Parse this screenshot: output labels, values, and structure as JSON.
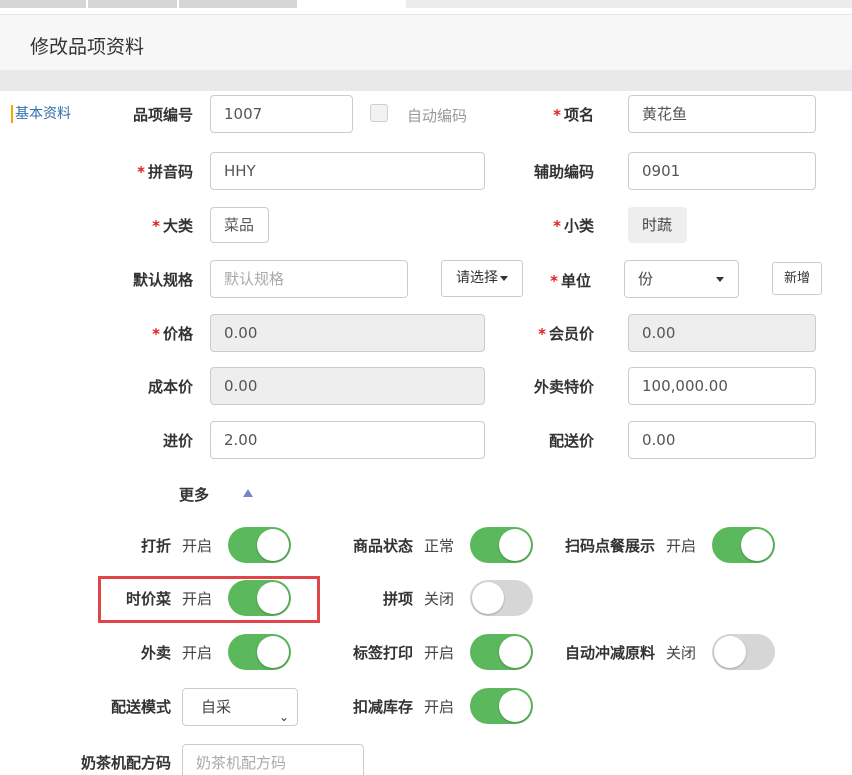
{
  "page": {
    "title": "修改品项资料",
    "side_tab": "基本资料"
  },
  "fields": {
    "code": {
      "label": "品项编号",
      "value": "1007"
    },
    "auto_code": {
      "label": "自动编码",
      "checked": false
    },
    "name": {
      "label": "项名",
      "required": true,
      "value": "黄花鱼"
    },
    "pinyin": {
      "label": "拼音码",
      "required": true,
      "value": "HHY"
    },
    "aux_code": {
      "label": "辅助编码",
      "value": "0901"
    },
    "category": {
      "label": "大类",
      "required": true,
      "value": "菜品"
    },
    "subcategory": {
      "label": "小类",
      "required": true,
      "value": "时蔬"
    },
    "default_spec": {
      "label": "默认规格",
      "placeholder": "默认规格",
      "select_button": "请选择"
    },
    "unit": {
      "label": "单位",
      "required": true,
      "value": "份",
      "add_button": "新增"
    },
    "price": {
      "label": "价格",
      "required": true,
      "value": "0.00"
    },
    "member_price": {
      "label": "会员价",
      "required": true,
      "value": "0.00"
    },
    "cost_price": {
      "label": "成本价",
      "value": "0.00"
    },
    "takeout_special": {
      "label": "外卖特价",
      "value": "100,000.00"
    },
    "purchase_price": {
      "label": "进价",
      "value": "2.00"
    },
    "delivery_price": {
      "label": "配送价",
      "value": "0.00"
    }
  },
  "more": {
    "label": "更多"
  },
  "toggles": {
    "discount": {
      "label": "打折",
      "state_text": "开启",
      "on": true
    },
    "product_status": {
      "label": "商品状态",
      "state_text": "正常",
      "on": true
    },
    "scan_order_display": {
      "label": "扫码点餐展示",
      "state_text": "开启",
      "on": true
    },
    "seasonal_dish": {
      "label": "时价菜",
      "state_text": "开启",
      "on": true
    },
    "combo_item": {
      "label": "拼项",
      "state_text": "关闭",
      "on": false
    },
    "takeout": {
      "label": "外卖",
      "state_text": "开启",
      "on": true
    },
    "label_print": {
      "label": "标签打印",
      "state_text": "开启",
      "on": true
    },
    "auto_deduct_material": {
      "label": "自动冲减原料",
      "state_text": "关闭",
      "on": false
    },
    "deduct_stock": {
      "label": "扣减库存",
      "state_text": "开启",
      "on": true
    }
  },
  "delivery_mode": {
    "label": "配送模式",
    "value": "自采"
  },
  "milk_tea": {
    "label": "奶茶机配方码",
    "placeholder": "奶茶机配方码"
  },
  "colors": {
    "accent_green": "#5cb85c",
    "required_red": "#e02020",
    "highlight_red": "#e0454a"
  }
}
